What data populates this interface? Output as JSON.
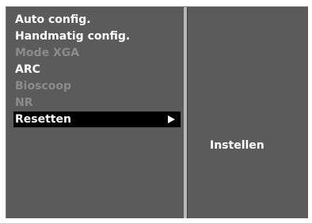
{
  "menu": {
    "items": [
      {
        "label": "Auto config.",
        "enabled": true
      },
      {
        "label": "Handmatig config.",
        "enabled": true
      },
      {
        "label": "Mode XGA",
        "enabled": false
      },
      {
        "label": "ARC",
        "enabled": true
      },
      {
        "label": "Bioscoop",
        "enabled": false
      },
      {
        "label": "NR",
        "enabled": false
      },
      {
        "label": "Resetten",
        "enabled": true,
        "selected": true,
        "icon": "arrow-right-icon"
      }
    ]
  },
  "submenu": {
    "items": [
      {
        "label": "Instellen"
      }
    ]
  },
  "colors": {
    "panel": "#5b5b5b",
    "divider": "#b8b8b8",
    "disabled_text": "#8b8b8b",
    "selected_bg": "#000000",
    "text": "#ffffff"
  }
}
